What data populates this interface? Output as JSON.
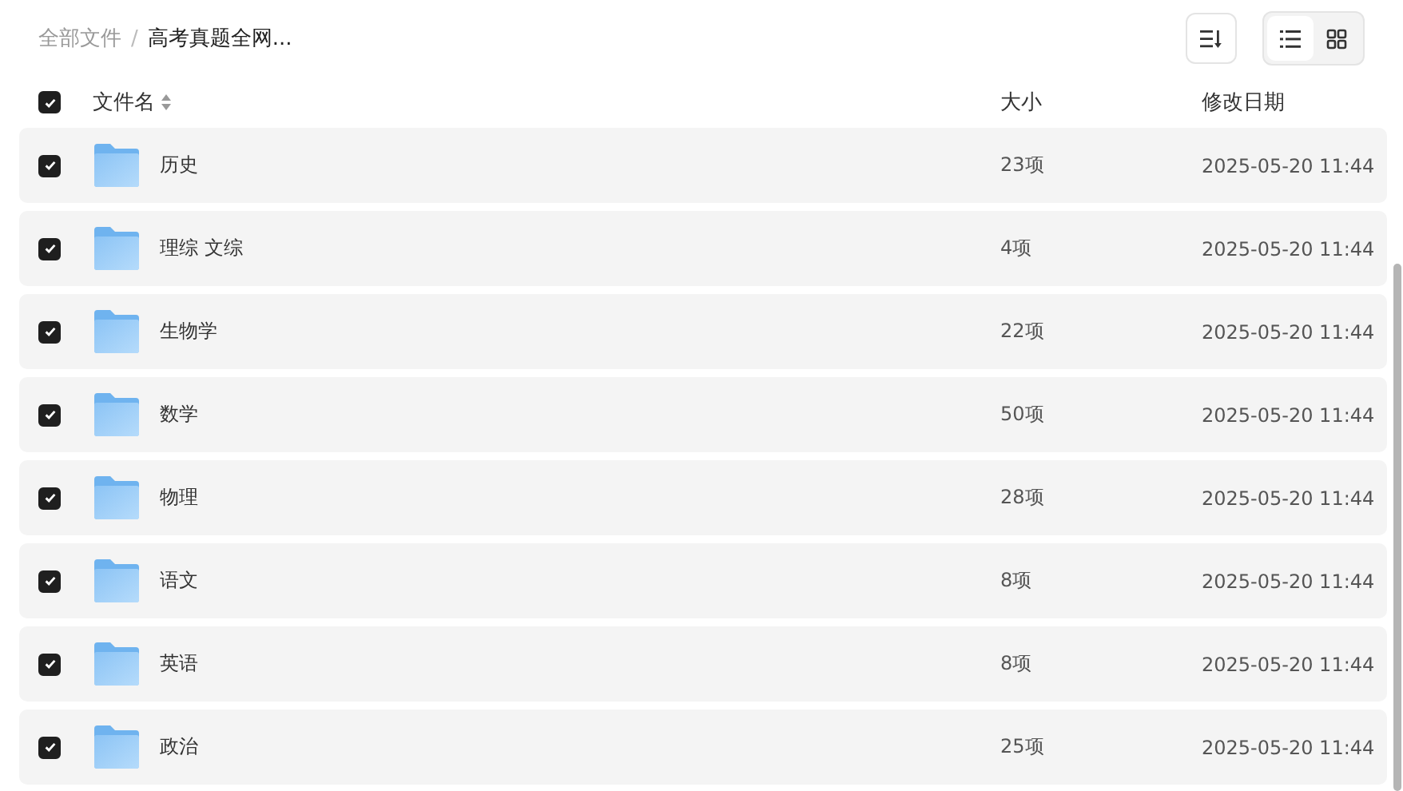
{
  "breadcrumb_separator": "/",
  "breadcrumb": [
    {
      "label": "全部文件",
      "current": false
    },
    {
      "label": "高考真题全网...",
      "current": true
    }
  ],
  "view_modes": [
    {
      "kind": "list",
      "selected": true
    },
    {
      "kind": "grid",
      "selected": false
    }
  ],
  "table": {
    "select_all_checked": true,
    "columns": [
      "文件名",
      "大小",
      "修改日期"
    ],
    "rows": [
      {
        "name": "历史",
        "size": "23项",
        "modified": "2025-05-20 11:44",
        "checked": true
      },
      {
        "name": "理综 文综",
        "size": "4项",
        "modified": "2025-05-20 11:44",
        "checked": true
      },
      {
        "name": "生物学",
        "size": "22项",
        "modified": "2025-05-20 11:44",
        "checked": true
      },
      {
        "name": "数学",
        "size": "50项",
        "modified": "2025-05-20 11:44",
        "checked": true
      },
      {
        "name": "物理",
        "size": "28项",
        "modified": "2025-05-20 11:44",
        "checked": true
      },
      {
        "name": "语文",
        "size": "8项",
        "modified": "2025-05-20 11:44",
        "checked": true
      },
      {
        "name": "英语",
        "size": "8项",
        "modified": "2025-05-20 11:44",
        "checked": true
      },
      {
        "name": "政治",
        "size": "25项",
        "modified": "2025-05-20 11:44",
        "checked": true
      }
    ]
  }
}
